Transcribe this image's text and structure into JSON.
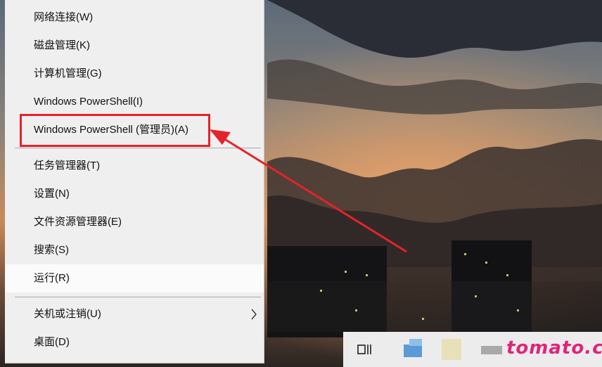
{
  "menu": {
    "items": [
      {
        "label": "网络连接(W)"
      },
      {
        "label": "磁盘管理(K)"
      },
      {
        "label": "计算机管理(G)"
      },
      {
        "label": "Windows PowerShell(I)"
      },
      {
        "label": "Windows PowerShell (管理员)(A)"
      },
      {
        "label": "任务管理器(T)"
      },
      {
        "label": "设置(N)"
      },
      {
        "label": "文件资源管理器(E)"
      },
      {
        "label": "搜索(S)"
      },
      {
        "label": "运行(R)"
      },
      {
        "label": "关机或注销(U)"
      },
      {
        "label": "桌面(D)"
      }
    ]
  },
  "watermark": "tomato.cm",
  "colors": {
    "highlight": "#e4232b",
    "menu_bg": "#efefef",
    "watermark": "#e0247a"
  },
  "icons": [
    "chevron-right-icon",
    "task-view-icon",
    "app-icon"
  ]
}
